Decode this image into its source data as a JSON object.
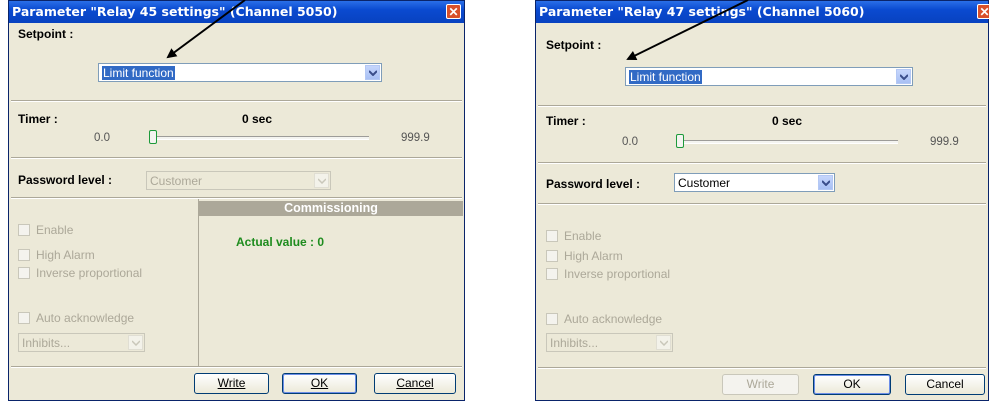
{
  "dialog1": {
    "title": "Parameter \"Relay 45 settings\" (Channel 5050)",
    "close_glyph": "✕",
    "setpoint_label": "Setpoint :",
    "setpoint_value": "Limit function",
    "timer_label": "Timer :",
    "timer_value": "0 sec",
    "timer_min": "0.0",
    "timer_max": "999.9",
    "timer_position": 0.0,
    "password_label": "Password level :",
    "password_value": "Customer",
    "password_enabled": false,
    "checkboxes": [
      "Enable",
      "High Alarm",
      "Inverse proportional"
    ],
    "auto_ack_label": "Auto acknowledge",
    "inhibits_value": "Inhibits...",
    "commissioning_title": "Commissioning",
    "actual_value": "Actual value : 0",
    "buttons": {
      "write": "Write",
      "ok": "OK",
      "cancel": "Cancel"
    }
  },
  "dialog2": {
    "title": "Parameter \"Relay 47 settings\" (Channel 5060)",
    "close_glyph": "✕",
    "setpoint_label": "Setpoint :",
    "setpoint_value": "Limit function",
    "timer_label": "Timer :",
    "timer_value": "0 sec",
    "timer_min": "0.0",
    "timer_max": "999.9",
    "timer_position": 0.0,
    "password_label": "Password level :",
    "password_value": "Customer",
    "password_enabled": true,
    "checkboxes": [
      "Enable",
      "High Alarm",
      "Inverse proportional"
    ],
    "auto_ack_label": "Auto acknowledge",
    "inhibits_value": "Inhibits...",
    "buttons": {
      "write": "Write",
      "ok": "OK",
      "cancel": "Cancel"
    }
  },
  "annotation_arrows": 2
}
